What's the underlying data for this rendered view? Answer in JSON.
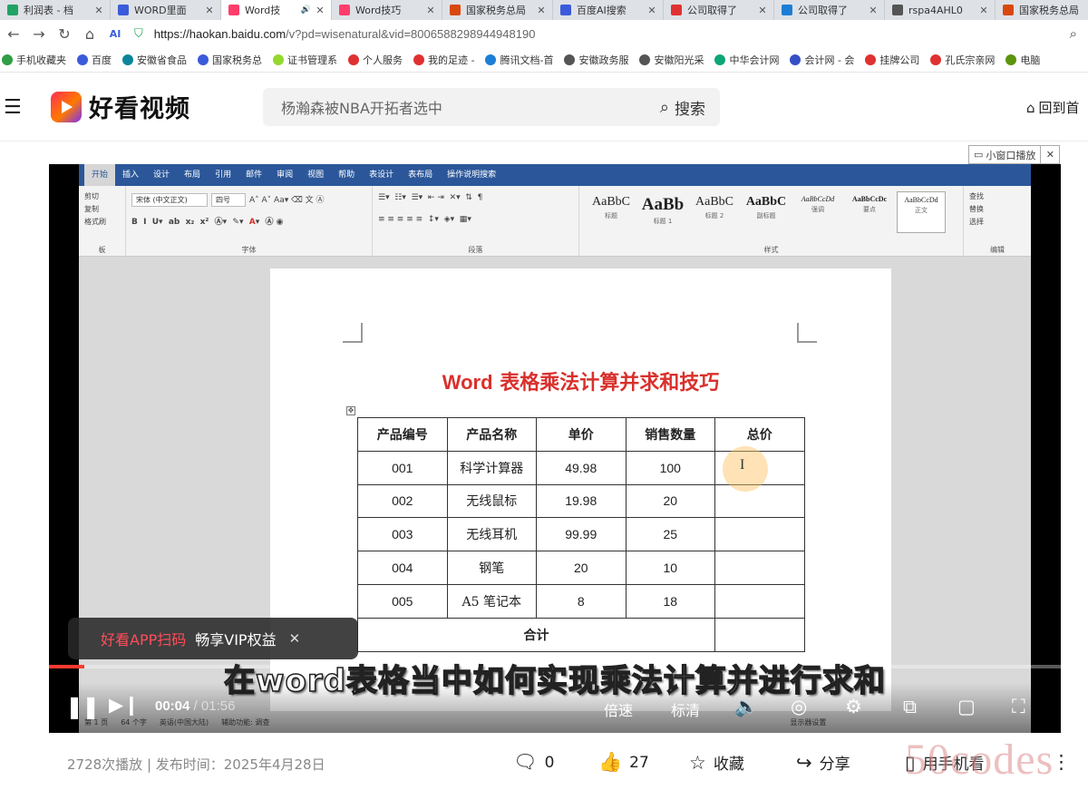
{
  "browser": {
    "tabs": [
      {
        "label": "利润表 - 档",
        "color": "#21a366",
        "active": false
      },
      {
        "label": "WORD里面",
        "color": "#3b5bdb",
        "active": false
      },
      {
        "label": "Word技",
        "color": "#ff3d6b",
        "active": true
      },
      {
        "label": "Word技巧",
        "color": "#ff3d6b",
        "active": false
      },
      {
        "label": "国家税务总局",
        "color": "#d9480f",
        "active": false
      },
      {
        "label": "百度AI搜索",
        "color": "#3b5bdb",
        "active": false
      },
      {
        "label": "公司取得了",
        "color": "#e03131",
        "active": false
      },
      {
        "label": "公司取得了",
        "color": "#1c7ed6",
        "active": false
      },
      {
        "label": "rspa4AHL0",
        "color": "#555555",
        "active": false
      },
      {
        "label": "国家税务总局",
        "color": "#d9480f",
        "active": false
      }
    ],
    "url_host": "https://haokan.baidu.com",
    "url_path": "/v?pd=wisenatural&vid=8006588298944948190",
    "bookmarks": [
      {
        "label": "手机收藏夹",
        "color": "#2f9e44"
      },
      {
        "label": "百度",
        "color": "#3b5bdb"
      },
      {
        "label": "安徽省食品",
        "color": "#0c8599"
      },
      {
        "label": "国家税务总",
        "color": "#3b5bdb"
      },
      {
        "label": "证书管理系",
        "color": "#94d82d"
      },
      {
        "label": "个人服务",
        "color": "#e03131"
      },
      {
        "label": "我的足迹 -",
        "color": "#e03131"
      },
      {
        "label": "腾讯文档-首",
        "color": "#1c7ed6"
      },
      {
        "label": "安徽政务服",
        "color": "#555555"
      },
      {
        "label": "安徽阳光采",
        "color": "#555555"
      },
      {
        "label": "中华会计网",
        "color": "#0ca678"
      },
      {
        "label": "会计网 - 会",
        "color": "#364fc7"
      },
      {
        "label": "挂牌公司",
        "color": "#e03131"
      },
      {
        "label": "孔氏宗亲网",
        "color": "#e03131"
      },
      {
        "label": "电脑",
        "color": "#5c940d"
      }
    ]
  },
  "site": {
    "logo_text": "好看视频",
    "search_placeholder": "杨瀚森被NBA开拓者选中",
    "search_button": "搜索",
    "home_link": "回到首"
  },
  "mini_window": {
    "label": "小窗口播放",
    "close": "✕"
  },
  "word": {
    "tabs": [
      "开始",
      "插入",
      "设计",
      "布局",
      "引用",
      "邮件",
      "审阅",
      "视图",
      "帮助",
      "表设计",
      "表布局",
      "操作说明搜索"
    ],
    "font_name": "宋体 (中文正文)",
    "font_size": "四号",
    "group_labels": {
      "clipboard": "板",
      "font": "字体",
      "paragraph": "段落",
      "styles": "样式",
      "editing": "编辑"
    },
    "clipboard_items": [
      "剪切",
      "复制",
      "格式刷"
    ],
    "editing_items": [
      "查找",
      "替换",
      "选择"
    ],
    "styles": [
      {
        "sample": "AaBbC",
        "name": "标题"
      },
      {
        "sample": "AaBb",
        "name": "标题 1"
      },
      {
        "sample": "AaBbC",
        "name": "标题 2"
      },
      {
        "sample": "AaBbC",
        "name": "副标题"
      },
      {
        "sample": "AaBbCcDd",
        "name": "强调"
      },
      {
        "sample": "AaBbCcDc",
        "name": "要点"
      },
      {
        "sample": "AaBbCcDd",
        "name": "正文"
      }
    ],
    "doc_title_en": "Word",
    "doc_title_cn": " 表格乘法计算并求和技巧",
    "table": {
      "headers": [
        "产品编号",
        "产品名称",
        "单价",
        "销售数量",
        "总价"
      ],
      "rows": [
        [
          "001",
          "科学计算器",
          "49.98",
          "100",
          ""
        ],
        [
          "002",
          "无线鼠标",
          "19.98",
          "20",
          ""
        ],
        [
          "003",
          "无线耳机",
          "99.99",
          "25",
          ""
        ],
        [
          "004",
          "钢笔",
          "20",
          "10",
          ""
        ],
        [
          "005",
          "A5 笔记本",
          "8",
          "18",
          ""
        ]
      ],
      "total_label": "合计"
    },
    "status": [
      "第 1 页",
      "64 个字",
      "英语(中国大陆)",
      "辅助功能: 调查",
      "显示器设置"
    ]
  },
  "player": {
    "promo_highlight": "好看APP扫码",
    "promo_text": "畅享VIP权益",
    "promo_close": "✕",
    "subtitle": "在word表格当中如何实现乘法计算并进行求和",
    "current_time": "00:04",
    "duration": "01:56",
    "progress": 0.035,
    "speed_label": "倍速",
    "quality_label": "标清"
  },
  "meta": {
    "info": "2728次播放 | 发布时间：2025年4月28日",
    "comments": "0",
    "likes": "27",
    "favorite": "收藏",
    "share": "分享",
    "phone": "用手机看",
    "watermark": "50codes"
  }
}
